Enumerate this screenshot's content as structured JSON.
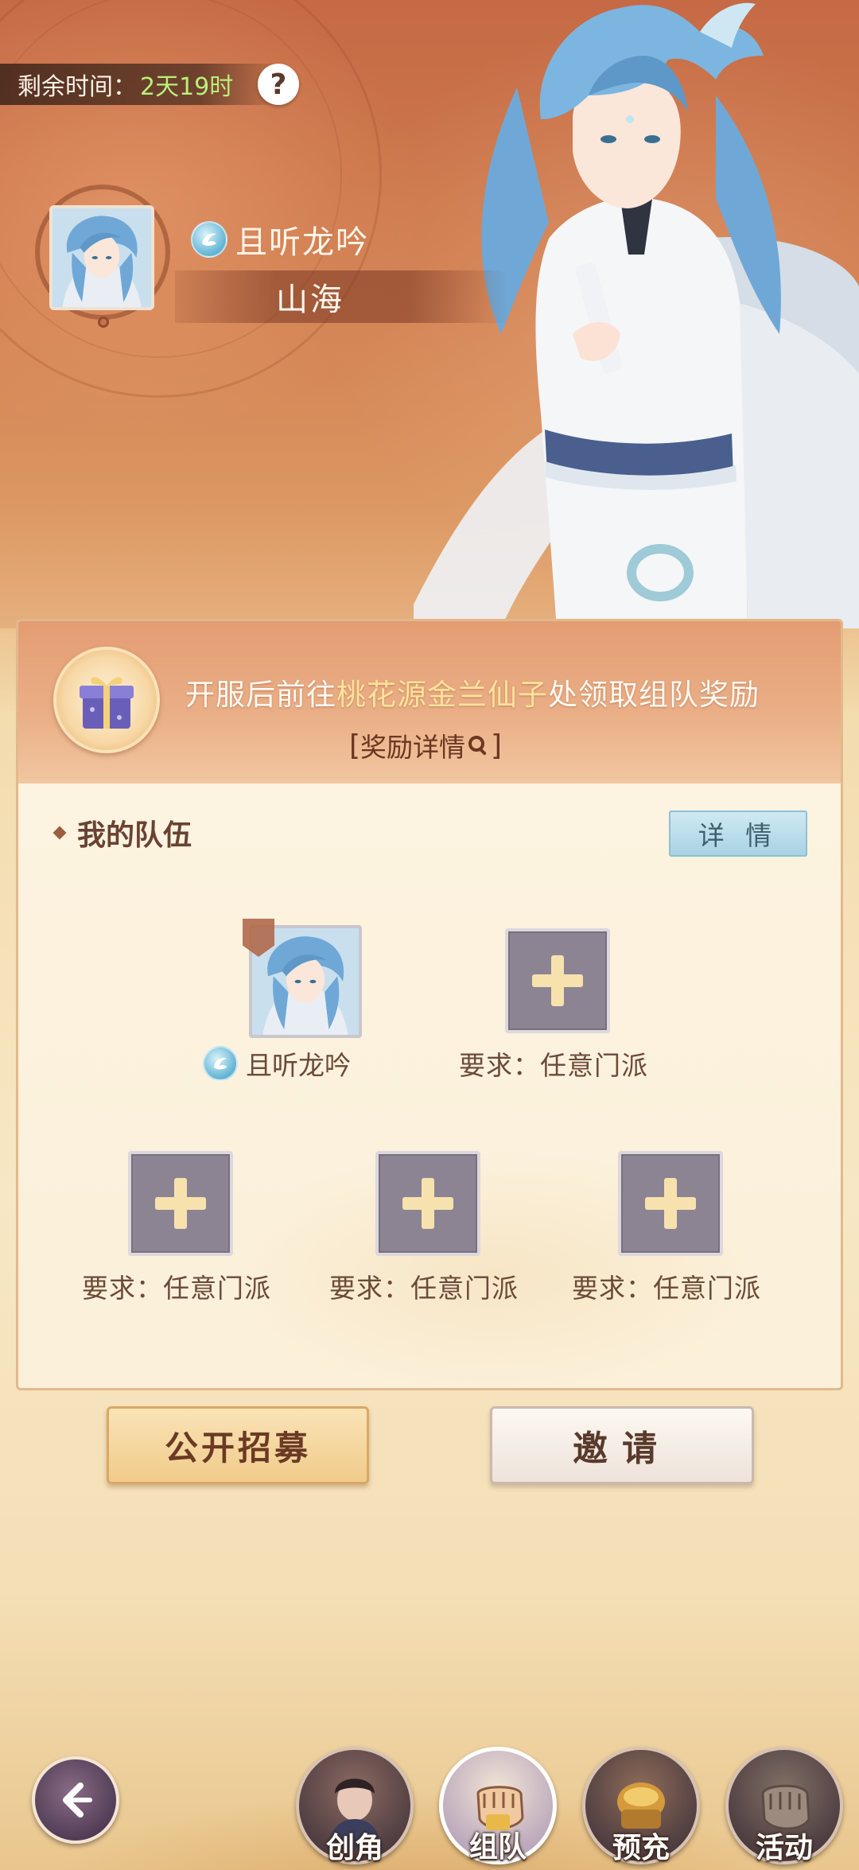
{
  "timer": {
    "label": "剩余时间：",
    "value": "2天19时"
  },
  "player": {
    "name": "且听龙吟",
    "server": "山海"
  },
  "reward": {
    "text_prefix": "开服后前往",
    "text_highlight": "桃花源金兰仙子",
    "text_suffix": "处领取组队奖励",
    "link_label": "奖励详情",
    "link_bracket_open": "[",
    "link_bracket_close": "]"
  },
  "team": {
    "title": "我的队伍",
    "detail_button": "详 情",
    "member": {
      "name": "且听龙吟"
    },
    "slots": [
      {
        "label": "要求：任意门派"
      },
      {
        "label": "要求：任意门派"
      },
      {
        "label": "要求：任意门派"
      },
      {
        "label": "要求：任意门派"
      }
    ]
  },
  "buttons": {
    "recruit": "公开招募",
    "invite": "邀请"
  },
  "nav": {
    "items": [
      {
        "label": "创角",
        "icon": "character-icon"
      },
      {
        "label": "组队",
        "icon": "fist-icon",
        "active": true
      },
      {
        "label": "预充",
        "icon": "treasure-icon"
      },
      {
        "label": "活动",
        "icon": "gauntlet-icon"
      }
    ]
  },
  "colors": {
    "accent_highlight": "#ffe39a",
    "timer_value": "#b8f07a",
    "detail_button_bg": "#a9d3e3",
    "slot_bg": "#8c8493"
  }
}
